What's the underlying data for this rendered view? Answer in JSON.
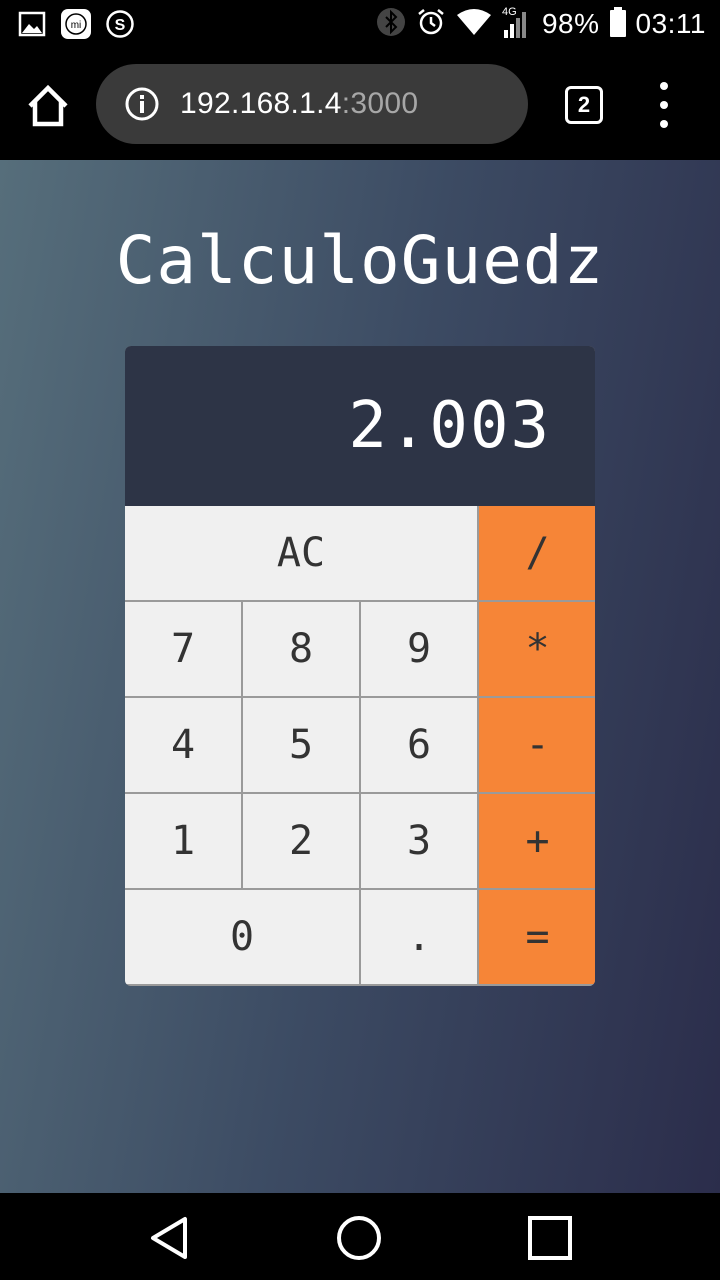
{
  "status_bar": {
    "notification_icons": [
      "gallery-icon",
      "mi-icon",
      "s-icon"
    ],
    "battery_percent": "98%",
    "time": "03:11",
    "network_label": "4G"
  },
  "browser": {
    "url_host": "192.168.1.4",
    "url_port": ":3000",
    "tab_count": "2"
  },
  "app": {
    "title": "CalculoGuedz",
    "display_value": "2.003",
    "keys": {
      "clear": "AC",
      "divide": "/",
      "seven": "7",
      "eight": "8",
      "nine": "9",
      "multiply": "*",
      "four": "4",
      "five": "5",
      "six": "6",
      "subtract": "-",
      "one": "1",
      "two": "2",
      "three": "3",
      "add": "+",
      "zero": "0",
      "decimal": ".",
      "equals": "="
    },
    "colors": {
      "operator": "#f68537",
      "key": "#f0f0f0",
      "display": "#2d3446"
    }
  }
}
